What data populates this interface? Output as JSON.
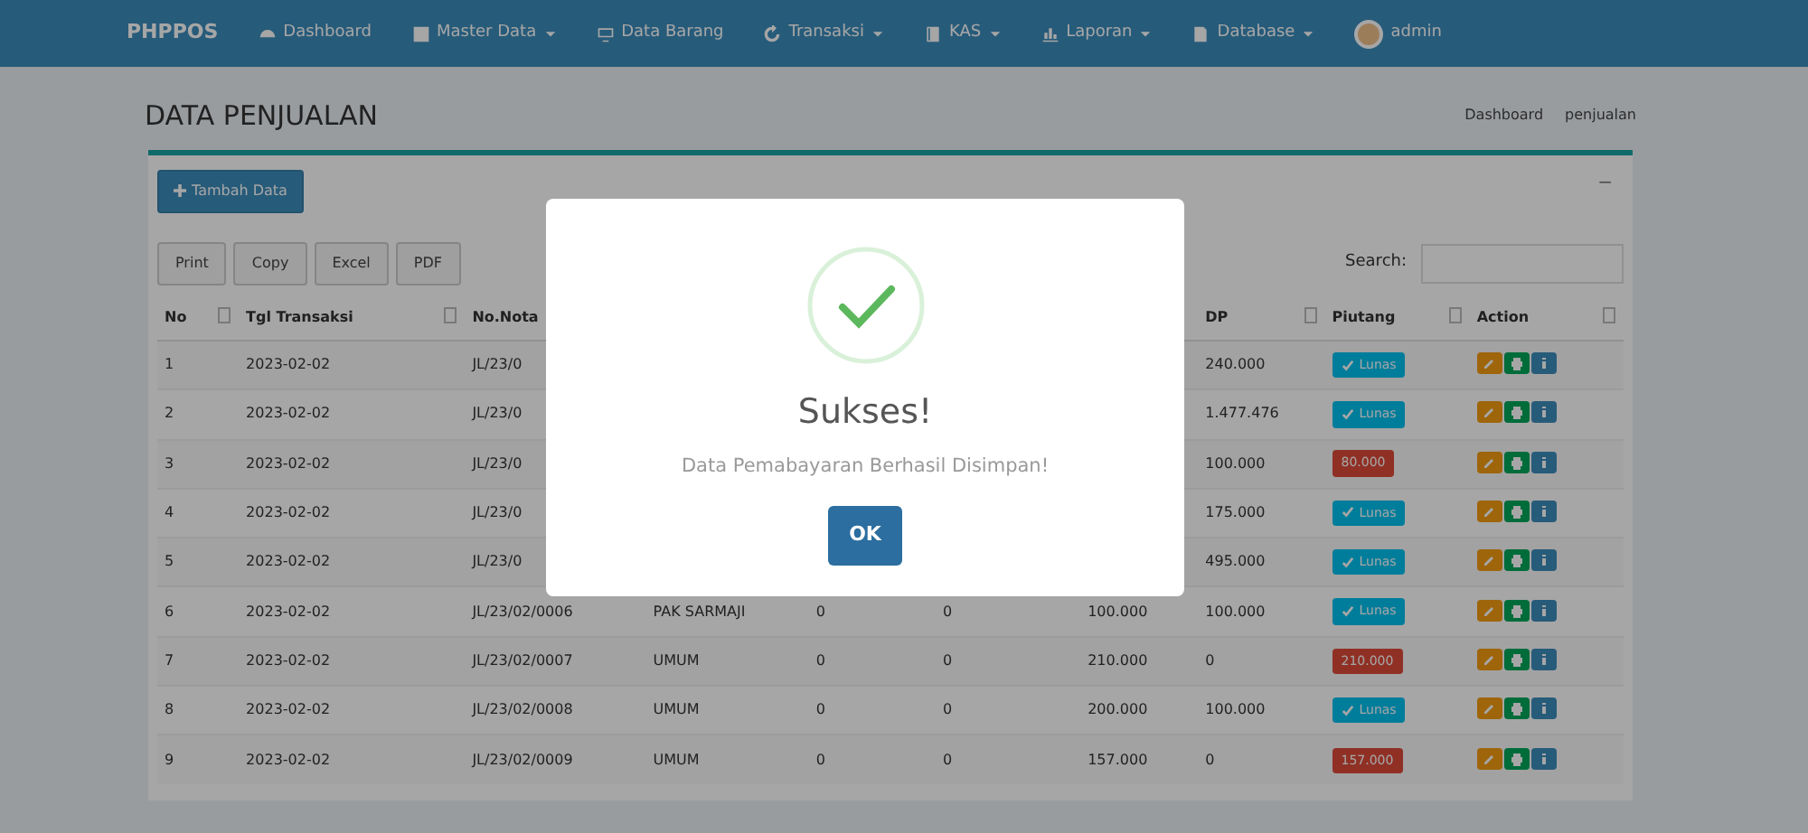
{
  "navbar": {
    "brand": "PHPPOS",
    "items": [
      {
        "label": "Dashboard",
        "dropdown": false
      },
      {
        "label": "Master Data",
        "dropdown": true
      },
      {
        "label": "Data Barang",
        "dropdown": false
      },
      {
        "label": "Transaksi",
        "dropdown": true
      },
      {
        "label": "KAS",
        "dropdown": true
      },
      {
        "label": "Laporan",
        "dropdown": true
      },
      {
        "label": "Database",
        "dropdown": true
      }
    ],
    "user": "admin"
  },
  "page": {
    "title": "DATA PENJUALAN",
    "breadcrumb": [
      "Dashboard",
      "penjualan"
    ]
  },
  "box": {
    "add_button": "Tambah Data",
    "collapse_button": "−",
    "export_buttons": [
      "Print",
      "Copy",
      "Excel",
      "PDF"
    ],
    "search_label": "Search:"
  },
  "table": {
    "columns": [
      "No",
      "Tgl Transaksi",
      "No.Nota",
      "DP",
      "Piutang",
      "Action"
    ],
    "rows": [
      {
        "no": "1",
        "date": "2023-02-02",
        "nota": "JL/23/0",
        "dp": "240.000",
        "piutang": {
          "kind": "paid",
          "text": "Lunas"
        }
      },
      {
        "no": "2",
        "date": "2023-02-02",
        "nota": "JL/23/0",
        "dp": "1.477.476",
        "piutang": {
          "kind": "paid",
          "text": "Lunas"
        }
      },
      {
        "no": "3",
        "date": "2023-02-02",
        "nota": "JL/23/0",
        "dp": "100.000",
        "piutang": {
          "kind": "debt",
          "text": "80.000"
        }
      },
      {
        "no": "4",
        "date": "2023-02-02",
        "nota": "JL/23/0",
        "dp": "175.000",
        "piutang": {
          "kind": "paid",
          "text": "Lunas"
        }
      },
      {
        "no": "5",
        "date": "2023-02-02",
        "nota": "JL/23/0",
        "dp": "495.000",
        "piutang": {
          "kind": "paid",
          "text": "Lunas"
        }
      },
      {
        "no": "6",
        "date": "2023-02-02",
        "nota": "JL/23/02/0006",
        "column_4": "PAK SARMAJI",
        "column_5": "0",
        "column_6": "0",
        "column_7": "100.000",
        "dp": "100.000",
        "piutang": {
          "kind": "paid",
          "text": "Lunas"
        }
      },
      {
        "no": "7",
        "date": "2023-02-02",
        "nota": "JL/23/02/0007",
        "column_4": "UMUM",
        "column_5": "0",
        "column_6": "0",
        "column_7": "210.000",
        "dp": "0",
        "piutang": {
          "kind": "debt",
          "text": "210.000"
        }
      },
      {
        "no": "8",
        "date": "2023-02-02",
        "nota": "JL/23/02/0008",
        "column_4": "UMUM",
        "column_5": "0",
        "column_6": "0",
        "column_7": "200.000",
        "dp": "100.000",
        "piutang": {
          "kind": "paid",
          "text": "Lunas"
        }
      },
      {
        "no": "9",
        "date": "2023-02-02",
        "nota": "JL/23/02/0009",
        "column_4": "UMUM",
        "column_5": "0",
        "column_6": "0",
        "column_7": "157.000",
        "dp": "0",
        "piutang": {
          "kind": "debt",
          "text": "157.000"
        }
      }
    ]
  },
  "dialog": {
    "kind": "success",
    "title": "Sukses!",
    "message": "Data Pemabayaran Berhasil Disimpan!",
    "button": "OK"
  }
}
